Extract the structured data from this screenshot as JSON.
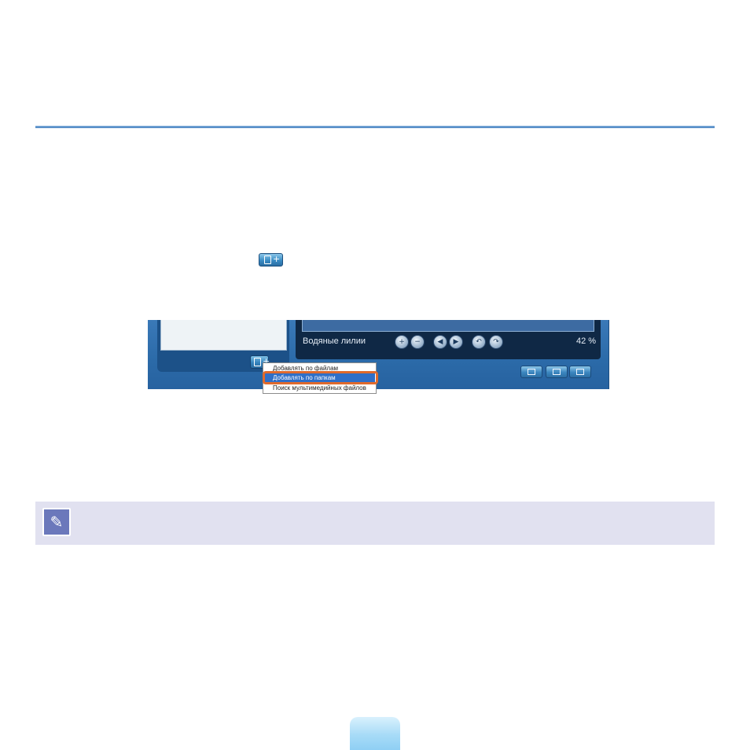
{
  "screenshot": {
    "caption": "Водяные лилии",
    "zoom": "42 %",
    "controls": [
      "zoom-in-icon",
      "zoom-out-icon",
      "previous-icon",
      "next-icon",
      "rotate-left-icon",
      "rotate-right-icon"
    ],
    "bottom_buttons": [
      "list-view-icon",
      "single-view-icon",
      "slideshow-icon"
    ],
    "menu": {
      "items": [
        "Добавлять по файлам",
        "Добавлять по папкам",
        "Поиск мультимедийных файлов"
      ],
      "highlighted": "Добавлять по папкам"
    }
  },
  "icons": {
    "inline": "add-file-icon",
    "note": "memo-pencil-icon"
  },
  "colors": {
    "rule": "#4f86c2",
    "app_frame": "#2b6aa8",
    "highlight_ring": "#e06a2c",
    "note_bg": "#e1e1f0",
    "note_icon": "#6b78bb",
    "page_tab": "#a7dbf7"
  }
}
